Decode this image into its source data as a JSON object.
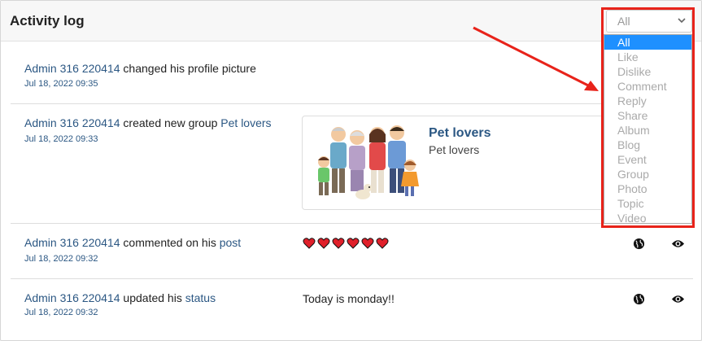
{
  "header": {
    "title": "Activity log"
  },
  "filter": {
    "selected": "All",
    "options": [
      "All",
      "Like",
      "Dislike",
      "Comment",
      "Reply",
      "Share",
      "Album",
      "Blog",
      "Event",
      "Group",
      "Photo",
      "Topic",
      "Video"
    ]
  },
  "activities": [
    {
      "actor": "Admin 316 220414",
      "action": " changed his profile picture",
      "date": "Jul 18, 2022 09:35"
    },
    {
      "actor": "Admin 316 220414",
      "action": " created new group ",
      "target": "Pet lovers",
      "date": "Jul 18, 2022 09:33",
      "card": {
        "name": "Pet lovers",
        "description": "Pet lovers"
      }
    },
    {
      "actor": "Admin 316 220414",
      "action": " commented on his ",
      "target": "post",
      "date": "Jul 18, 2022 09:32",
      "content_icons": [
        "heart-icon",
        "heart-icon",
        "heart-icon",
        "heart-icon",
        "heart-icon",
        "heart-icon"
      ]
    },
    {
      "actor": "Admin 316 220414",
      "action": " updated his ",
      "target": "status",
      "date": "Jul 18, 2022 09:32",
      "content_text": "Today is monday!!"
    }
  ],
  "colors": {
    "link": "#2b5783",
    "highlight": "#e8231a",
    "selected_option": "#1e90ff",
    "heart": "#e0202a"
  },
  "icons": {
    "privacy": "globe-icon",
    "view": "eye-icon",
    "select_caret": "chevron-down-icon"
  }
}
